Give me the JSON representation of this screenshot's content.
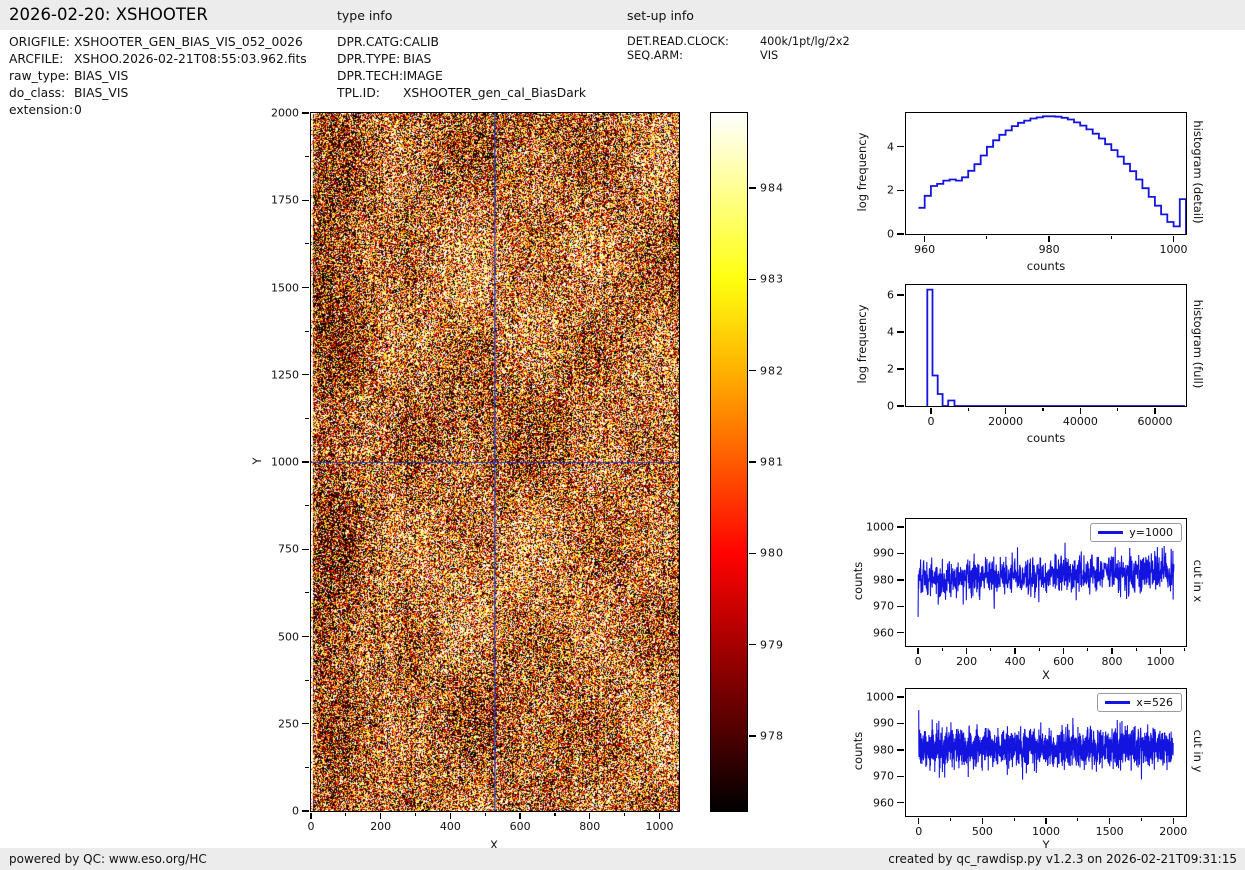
{
  "page": {
    "title": "2026-02-20: XSHOOTER"
  },
  "file_info": {
    "fields": [
      {
        "label": "ORIGFILE:",
        "value": "XSHOOTER_GEN_BIAS_VIS_052_0026"
      },
      {
        "label": "ARCFILE:",
        "value": "XSHOO.2026-02-21T08:55:03.962.fits"
      },
      {
        "label": "raw_type:",
        "value": "BIAS_VIS"
      },
      {
        "label": "do_class:",
        "value": "BIAS_VIS"
      },
      {
        "label": "extension:",
        "value": "0"
      }
    ]
  },
  "type_info": {
    "heading": "type info",
    "fields": [
      {
        "label": "DPR.CATG:",
        "value": "CALIB"
      },
      {
        "label": "DPR.TYPE:",
        "value": "BIAS"
      },
      {
        "label": "DPR.TECH:",
        "value": "IMAGE"
      },
      {
        "label": "TPL.ID:",
        "value": "XSHOOTER_gen_cal_BiasDark"
      }
    ]
  },
  "setup_info": {
    "heading": "set-up info",
    "fields": [
      {
        "label": "DET.READ.CLOCK:",
        "value": "400k/1pt/lg/2x2"
      },
      {
        "label": "SEQ.ARM:",
        "value": "VIS"
      }
    ]
  },
  "footer": {
    "left": "powered by QC: www.eso.org/HC",
    "right": "created by qc_rawdisp.py v1.2.3 on 2026-02-21T09:31:15"
  },
  "colors": {
    "plot_line": "#1414e0",
    "crosshair": "#2233bb",
    "spine": "#000000",
    "band_bg": "#ececec",
    "colorbar_stops": [
      [
        "0%",
        "#ffffff"
      ],
      [
        "10.7%",
        "#ffff94"
      ],
      [
        "23.8%",
        "#ffff10"
      ],
      [
        "36.9%",
        "#ffb200"
      ],
      [
        "50%",
        "#ff5a00"
      ],
      [
        "63.1%",
        "#ff0300"
      ],
      [
        "76.2%",
        "#a60000"
      ],
      [
        "89.3%",
        "#4b0000"
      ],
      [
        "100%",
        "#000000"
      ]
    ]
  },
  "chart_data": [
    {
      "id": "main-image",
      "type": "heatmap",
      "xlabel": "X",
      "ylabel": "Y",
      "x_range": [
        0,
        1056
      ],
      "y_range": [
        0,
        2000
      ],
      "x_ticks": [
        0,
        200,
        400,
        600,
        800,
        1000
      ],
      "x_minor_step": 100,
      "y_ticks": [
        0,
        250,
        500,
        750,
        1000,
        1250,
        1500,
        1750,
        2000
      ],
      "y_minor_step": 125,
      "crosshair": {
        "x": 526,
        "y": 1000
      },
      "noise": {
        "mean": 981,
        "sigma": 4.2,
        "vmin": 977.2,
        "vmax": 984.8,
        "seed": 20260220,
        "left_dark_amp": 1.5,
        "bright_left_cols": 2
      }
    },
    {
      "id": "colorbar",
      "type": "colorbar",
      "colormap": "hot",
      "vmin": 977.18,
      "vmax": 984.82,
      "ticks": [
        978,
        979,
        980,
        981,
        982,
        983,
        984
      ]
    },
    {
      "id": "hist-detail",
      "type": "hist-step",
      "xlabel": "counts",
      "ylabel": "log frequency",
      "right_label": "histogram (detail)",
      "x_range": [
        957,
        1002
      ],
      "y_range": [
        0,
        5.55
      ],
      "x_ticks": [
        960,
        980,
        1000
      ],
      "x_minor": [
        970,
        990
      ],
      "y_ticks": [
        0,
        2,
        4
      ],
      "bins_start": 959,
      "bin_width": 1,
      "values": [
        1.2,
        1.75,
        2.2,
        2.3,
        2.45,
        2.5,
        2.45,
        2.6,
        2.9,
        3.2,
        3.6,
        4.0,
        4.3,
        4.55,
        4.75,
        4.95,
        5.1,
        5.2,
        5.3,
        5.35,
        5.4,
        5.4,
        5.38,
        5.33,
        5.25,
        5.12,
        4.97,
        4.8,
        4.6,
        4.38,
        4.12,
        3.85,
        3.55,
        3.22,
        2.88,
        2.5,
        2.1,
        1.7,
        1.3,
        0.9,
        0.55,
        0.35,
        1.6
      ]
    },
    {
      "id": "hist-full",
      "type": "hist-segments",
      "xlabel": "counts",
      "ylabel": "log frequency",
      "right_label": "histogram (full)",
      "x_range": [
        -6700,
        68300
      ],
      "y_range": [
        0,
        6.55
      ],
      "x_ticks": [
        0,
        20000,
        40000,
        60000
      ],
      "x_minor": [
        10000,
        30000,
        50000
      ],
      "y_ticks": [
        0,
        2,
        4,
        6
      ],
      "segments": [
        [
          -1000,
          400,
          6.3
        ],
        [
          400,
          1800,
          1.65
        ],
        [
          1800,
          3100,
          0.65
        ],
        [
          3100,
          4600,
          0
        ],
        [
          4600,
          6300,
          0.3
        ],
        [
          6300,
          68000,
          0
        ]
      ]
    },
    {
      "id": "cut-x",
      "type": "noise-line",
      "legend": "y=1000",
      "xlabel": "X",
      "ylabel": "counts",
      "right_label": "cut in x",
      "x_range": [
        -50,
        1105
      ],
      "y_range": [
        955,
        1003
      ],
      "x_ticks": [
        0,
        200,
        400,
        600,
        800,
        1000
      ],
      "x_minor": [
        100,
        300,
        500,
        700,
        900,
        1100
      ],
      "y_ticks": [
        960,
        970,
        980,
        990,
        1000
      ],
      "series": {
        "n": 1056,
        "mean": 980.4,
        "trend": 0.0022,
        "sigma": 3.6,
        "min": 966,
        "max": 994,
        "first_value": 966,
        "seed": 777
      }
    },
    {
      "id": "cut-y",
      "type": "noise-line",
      "legend": "x=526",
      "xlabel": "Y",
      "ylabel": "counts",
      "right_label": "cut in y",
      "x_range": [
        -100,
        2100
      ],
      "y_range": [
        955,
        1003
      ],
      "x_ticks": [
        0,
        500,
        1000,
        1500,
        2000
      ],
      "x_minor": [
        250,
        750,
        1250,
        1750
      ],
      "y_ticks": [
        960,
        970,
        980,
        990,
        1000
      ],
      "series": {
        "n": 2000,
        "mean": 980.8,
        "trend": 0,
        "sigma": 3.6,
        "min": 967,
        "max": 995,
        "first_value": 995,
        "seed": 999
      }
    }
  ]
}
